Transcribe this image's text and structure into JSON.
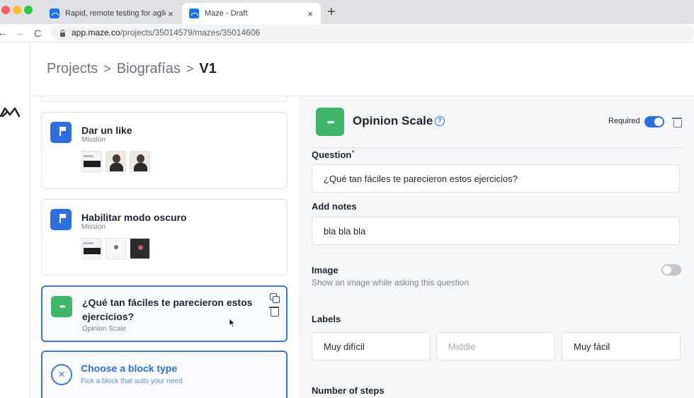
{
  "browser": {
    "tabs": [
      {
        "title": "Rapid, remote testing for agile",
        "close": "×"
      },
      {
        "title": "Maze - Draft",
        "close": "×"
      }
    ],
    "new_tab": "+",
    "nav": {
      "back": "←",
      "forward": "→",
      "reload": "C"
    },
    "url": {
      "host": "app.maze.co",
      "path": "/projects/35014579/mazes/35014606"
    }
  },
  "header": {
    "breadcrumbs": [
      {
        "label": "Projects"
      },
      {
        "label": "Biografías"
      }
    ],
    "separator": ">",
    "current": "V1"
  },
  "blocks": [
    {
      "title": "Dar un like",
      "type": "Mission",
      "icon": "mission-flag-icon"
    },
    {
      "title": "Habilitar modo oscuro",
      "type": "Mission",
      "icon": "mission-flag-icon"
    },
    {
      "title": "¿Qué tan fáciles te parecieron estos ejercicios?",
      "type": "Opinion Scale",
      "icon": "opinion-scale-icon"
    }
  ],
  "choose_block": {
    "title": "Choose a block type",
    "subtitle": "Pick a block that suits your need",
    "icon_glyph": "×"
  },
  "panel": {
    "title": "Opinion Scale",
    "help_glyph": "?",
    "required_label": "Required",
    "required_on": true,
    "question": {
      "label": "Question",
      "star": "*",
      "value": "¿Qué tan fáciles te parecieron estos ejercicios?"
    },
    "notes": {
      "label": "Add notes",
      "value": "bla bla bla"
    },
    "image": {
      "label": "Image",
      "description": "Show an image while asking this question",
      "enabled": false
    },
    "labels": {
      "label": "Labels",
      "left": "Muy difícil",
      "middle_placeholder": "Middle",
      "right": "Muy fácil"
    },
    "steps_label": "Number of steps"
  },
  "colors": {
    "accent_blue": "#2d6fe0",
    "opinion_green": "#3fb56a",
    "panel_bg": "#f5f6f8"
  }
}
